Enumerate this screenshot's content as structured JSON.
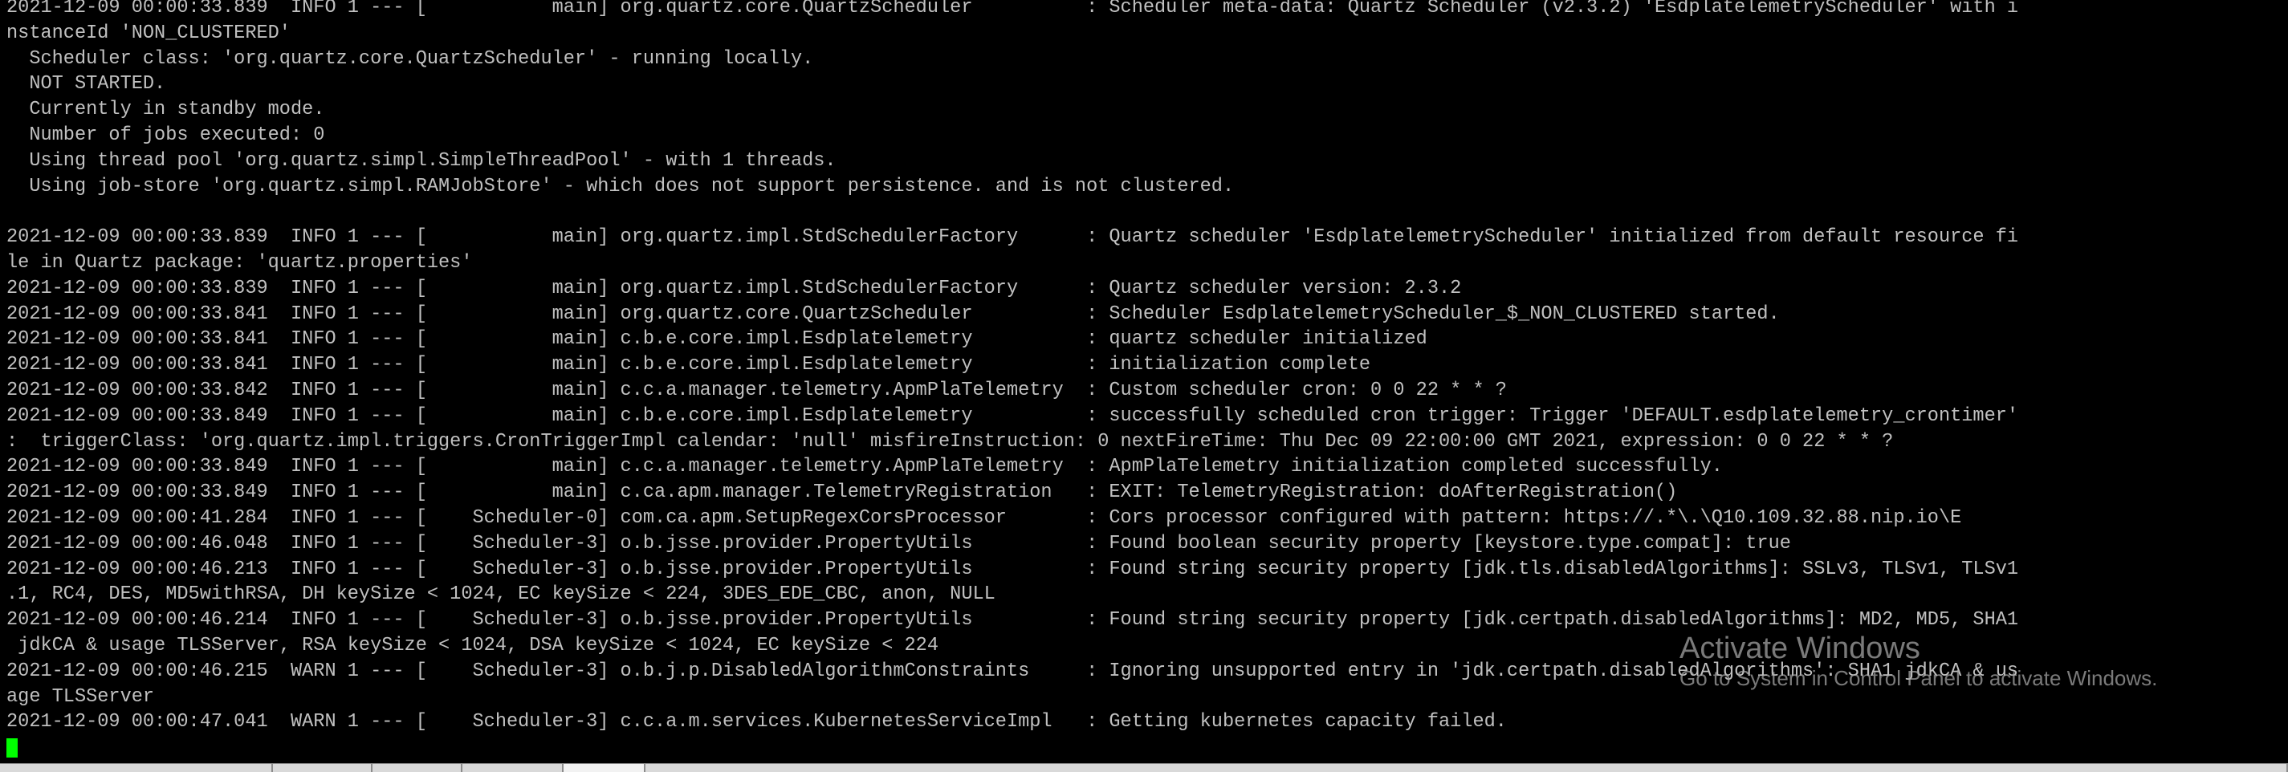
{
  "terminal": {
    "lines": [
      "2021-12-09 00:00:33.839  INFO 1 --- [           main] org.quartz.core.QuartzScheduler          : Scheduler meta-data: Quartz Scheduler (v2.3.2) 'EsdplatelemetryScheduler' with i",
      "nstanceId 'NON_CLUSTERED'",
      "  Scheduler class: 'org.quartz.core.QuartzScheduler' - running locally.",
      "  NOT STARTED.",
      "  Currently in standby mode.",
      "  Number of jobs executed: 0",
      "  Using thread pool 'org.quartz.simpl.SimpleThreadPool' - with 1 threads.",
      "  Using job-store 'org.quartz.simpl.RAMJobStore' - which does not support persistence. and is not clustered.",
      "",
      "2021-12-09 00:00:33.839  INFO 1 --- [           main] org.quartz.impl.StdSchedulerFactory      : Quartz scheduler 'EsdplatelemetryScheduler' initialized from default resource fi",
      "le in Quartz package: 'quartz.properties'",
      "2021-12-09 00:00:33.839  INFO 1 --- [           main] org.quartz.impl.StdSchedulerFactory      : Quartz scheduler version: 2.3.2",
      "2021-12-09 00:00:33.841  INFO 1 --- [           main] org.quartz.core.QuartzScheduler          : Scheduler EsdplatelemetryScheduler_$_NON_CLUSTERED started.",
      "2021-12-09 00:00:33.841  INFO 1 --- [           main] c.b.e.core.impl.Esdplatelemetry          : quartz scheduler initialized",
      "2021-12-09 00:00:33.841  INFO 1 --- [           main] c.b.e.core.impl.Esdplatelemetry          : initialization complete",
      "2021-12-09 00:00:33.842  INFO 1 --- [           main] c.c.a.manager.telemetry.ApmPlaTelemetry  : Custom scheduler cron: 0 0 22 * * ?",
      "2021-12-09 00:00:33.849  INFO 1 --- [           main] c.b.e.core.impl.Esdplatelemetry          : successfully scheduled cron trigger: Trigger 'DEFAULT.esdplatelemetry_crontimer'",
      ":  triggerClass: 'org.quartz.impl.triggers.CronTriggerImpl calendar: 'null' misfireInstruction: 0 nextFireTime: Thu Dec 09 22:00:00 GMT 2021, expression: 0 0 22 * * ?",
      "2021-12-09 00:00:33.849  INFO 1 --- [           main] c.c.a.manager.telemetry.ApmPlaTelemetry  : ApmPlaTelemetry initialization completed successfully.",
      "2021-12-09 00:00:33.849  INFO 1 --- [           main] c.ca.apm.manager.TelemetryRegistration   : EXIT: TelemetryRegistration: doAfterRegistration()",
      "2021-12-09 00:00:41.284  INFO 1 --- [    Scheduler-0] com.ca.apm.SetupRegexCorsProcessor       : Cors processor configured with pattern: https://.*\\.\\Q10.109.32.88.nip.io\\E",
      "2021-12-09 00:00:46.048  INFO 1 --- [    Scheduler-3] o.b.jsse.provider.PropertyUtils          : Found boolean security property [keystore.type.compat]: true",
      "2021-12-09 00:00:46.213  INFO 1 --- [    Scheduler-3] o.b.jsse.provider.PropertyUtils          : Found string security property [jdk.tls.disabledAlgorithms]: SSLv3, TLSv1, TLSv1",
      ".1, RC4, DES, MD5withRSA, DH keySize < 1024, EC keySize < 224, 3DES_EDE_CBC, anon, NULL",
      "2021-12-09 00:00:46.214  INFO 1 --- [    Scheduler-3] o.b.jsse.provider.PropertyUtils          : Found string security property [jdk.certpath.disabledAlgorithms]: MD2, MD5, SHA1",
      " jdkCA & usage TLSServer, RSA keySize < 1024, DSA keySize < 1024, EC keySize < 224",
      "2021-12-09 00:00:46.215  WARN 1 --- [    Scheduler-3] o.b.j.p.DisabledAlgorithmConstraints     : Ignoring unsupported entry in 'jdk.certpath.disabledAlgorithms': SHA1 jdkCA & us",
      "age TLSServer",
      "2021-12-09 00:00:47.041  WARN 1 --- [    Scheduler-3] c.c.a.m.services.KubernetesServiceImpl   : Getting kubernetes capacity failed."
    ],
    "colors": {
      "background": "#000000",
      "foreground": "#c0c0c0",
      "cursor": "#00ff00"
    }
  },
  "watermark": {
    "title": "Activate Windows",
    "subtitle": "Go to System in Control Panel to activate Windows."
  }
}
